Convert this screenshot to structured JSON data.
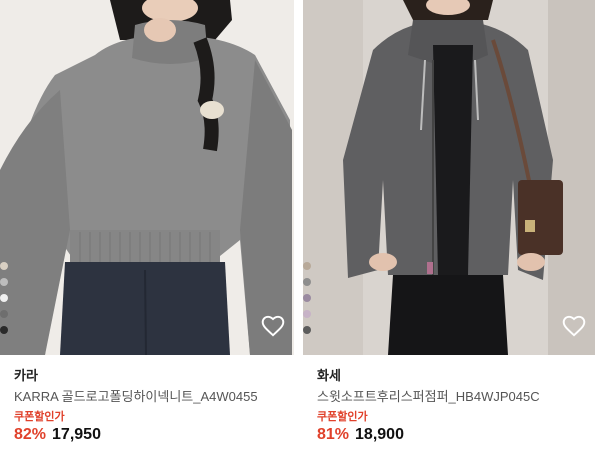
{
  "products": [
    {
      "brand": "카라",
      "name": "KARRA 골드로고폴딩하이넥니트_A4W0455",
      "coupon_label": "쿠폰할인가",
      "discount": "82%",
      "price": "17,950",
      "image_icon": "gray-knit-sweater-photo",
      "wishlist_icon": "heart-outline-icon",
      "swatch_colors": [
        "#d8cfc2",
        "#bdbdbd",
        "#f0f0f0",
        "#6e6e6e",
        "#2a2a2a"
      ]
    },
    {
      "brand": "화세",
      "name": "스윗소프트후리스퍼점퍼_HB4WJP045C",
      "coupon_label": "쿠폰할인가",
      "discount": "81%",
      "price": "18,900",
      "image_icon": "gray-fleece-jacket-photo",
      "wishlist_icon": "heart-outline-icon",
      "swatch_colors": [
        "#b8a999",
        "#8e8e8e",
        "#9a8aa0",
        "#c7b3c7",
        "#5c5c5c"
      ]
    }
  ],
  "colors": {
    "sale_red": "#e0412b",
    "text_dark": "#111111",
    "text_gray": "#555555"
  }
}
